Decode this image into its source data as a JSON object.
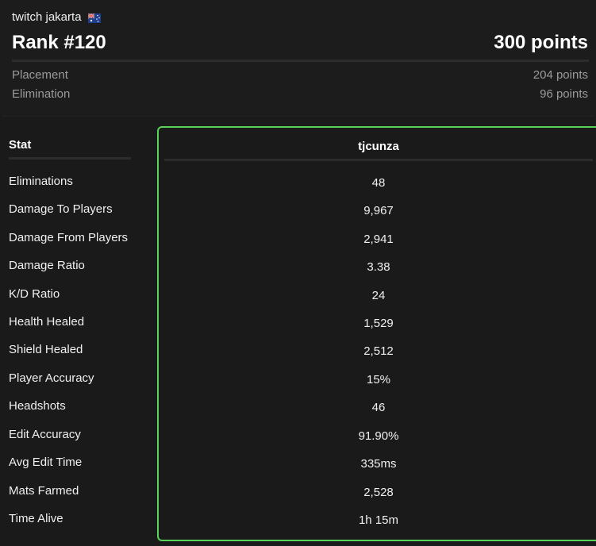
{
  "header": {
    "team_name": "twitch jakarta",
    "flag": "australia-flag-icon",
    "rank": "Rank #120",
    "total_points": "300 points",
    "breakdown": [
      {
        "label": "Placement",
        "value": "204 points"
      },
      {
        "label": "Elimination",
        "value": "96 points"
      }
    ]
  },
  "table": {
    "stat_header": "Stat",
    "player_name": "tjcunza",
    "accent_color": "#5ad35a",
    "rows": [
      {
        "label": "Eliminations",
        "value": "48"
      },
      {
        "label": "Damage To Players",
        "value": "9,967"
      },
      {
        "label": "Damage From Players",
        "value": "2,941"
      },
      {
        "label": "Damage Ratio",
        "value": "3.38"
      },
      {
        "label": "K/D Ratio",
        "value": "24"
      },
      {
        "label": "Health Healed",
        "value": "1,529"
      },
      {
        "label": "Shield Healed",
        "value": "2,512"
      },
      {
        "label": "Player Accuracy",
        "value": "15%"
      },
      {
        "label": "Headshots",
        "value": "46"
      },
      {
        "label": "Edit Accuracy",
        "value": "91.90%"
      },
      {
        "label": "Avg Edit Time",
        "value": "335ms"
      },
      {
        "label": "Mats Farmed",
        "value": "2,528"
      },
      {
        "label": "Time Alive",
        "value": "1h 15m"
      }
    ]
  }
}
